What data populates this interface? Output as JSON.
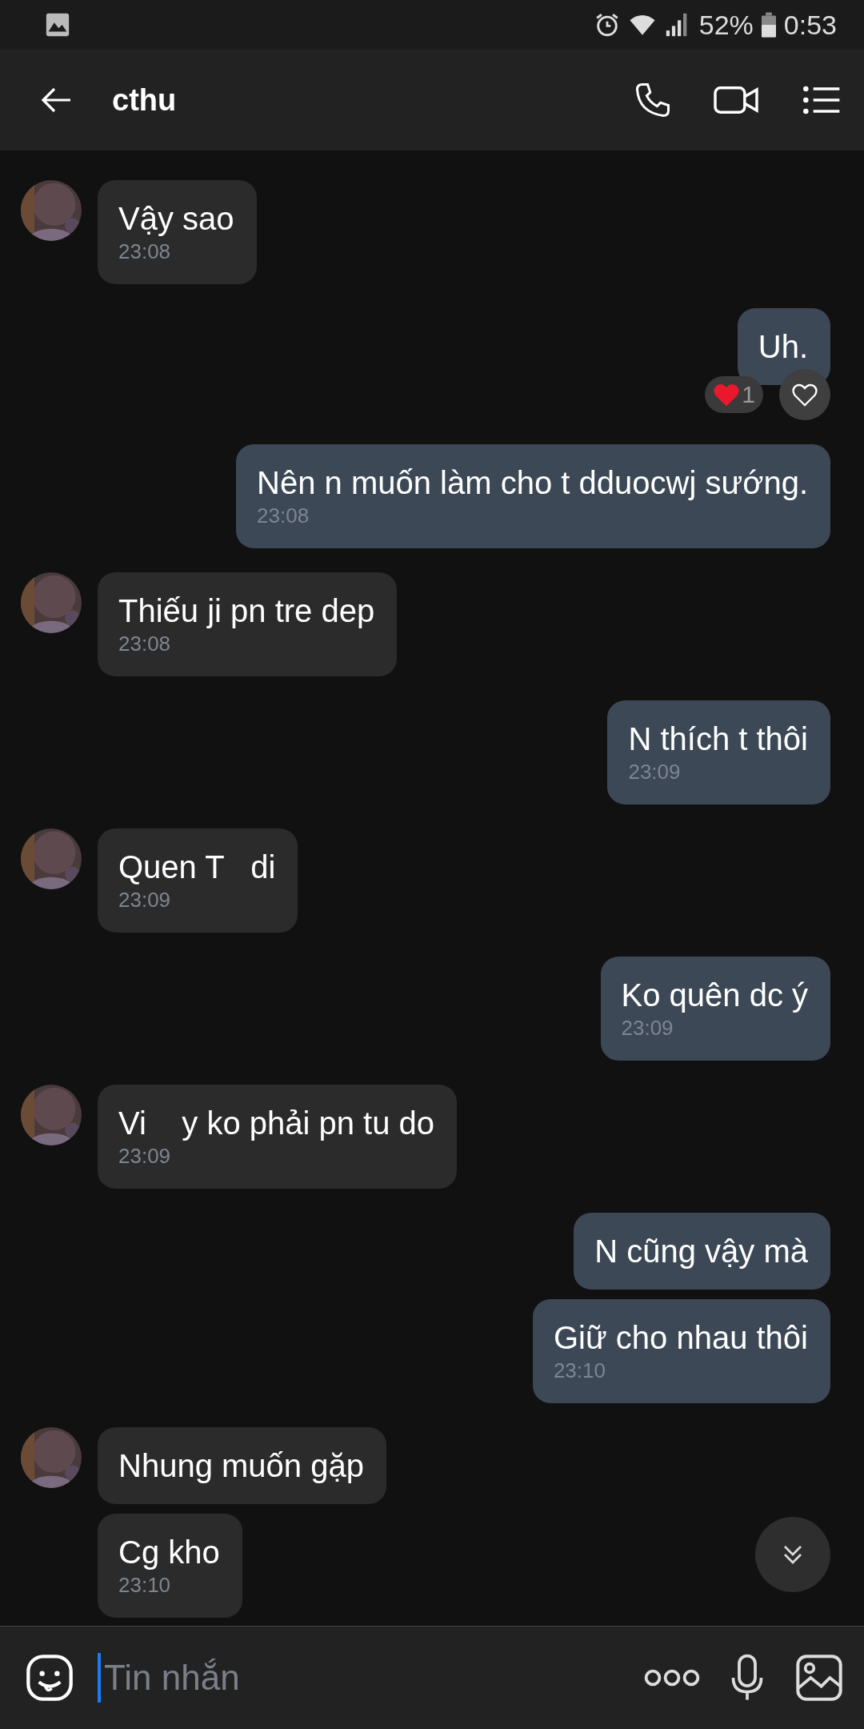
{
  "status_bar": {
    "battery": "52%",
    "time": "0:53"
  },
  "header": {
    "title": "cthu"
  },
  "messages": [
    {
      "kind": "received",
      "text": "Vậy sao",
      "time": "23:08"
    },
    {
      "kind": "sent",
      "text": "Uh.",
      "reactions": {
        "count": "1"
      }
    },
    {
      "kind": "sent",
      "text": "Nên n muốn làm cho t dduocwj sướng.",
      "time": "23:08"
    },
    {
      "kind": "received",
      "text": "Thiếu ji pn tre dep",
      "time": "23:08"
    },
    {
      "kind": "sent",
      "text": "N thích t thôi",
      "time": "23:09"
    },
    {
      "kind": "received",
      "text": "Quen T   di",
      "time": "23:09"
    },
    {
      "kind": "sent",
      "text": "Ko quên dc ý",
      "time": "23:09"
    },
    {
      "kind": "received",
      "text": "Vi    y ko phải pn tu do",
      "time": "23:09"
    },
    {
      "kind": "sent",
      "text": "N cũng vậy mà"
    },
    {
      "kind": "sent",
      "text": "Giữ cho nhau thôi",
      "time": "23:10"
    },
    {
      "kind": "received",
      "text": "Nhung muốn gặp"
    },
    {
      "kind": "received",
      "text": "Cg kho",
      "time": "23:10"
    }
  ],
  "composer": {
    "placeholder": "Tin nhắn"
  }
}
